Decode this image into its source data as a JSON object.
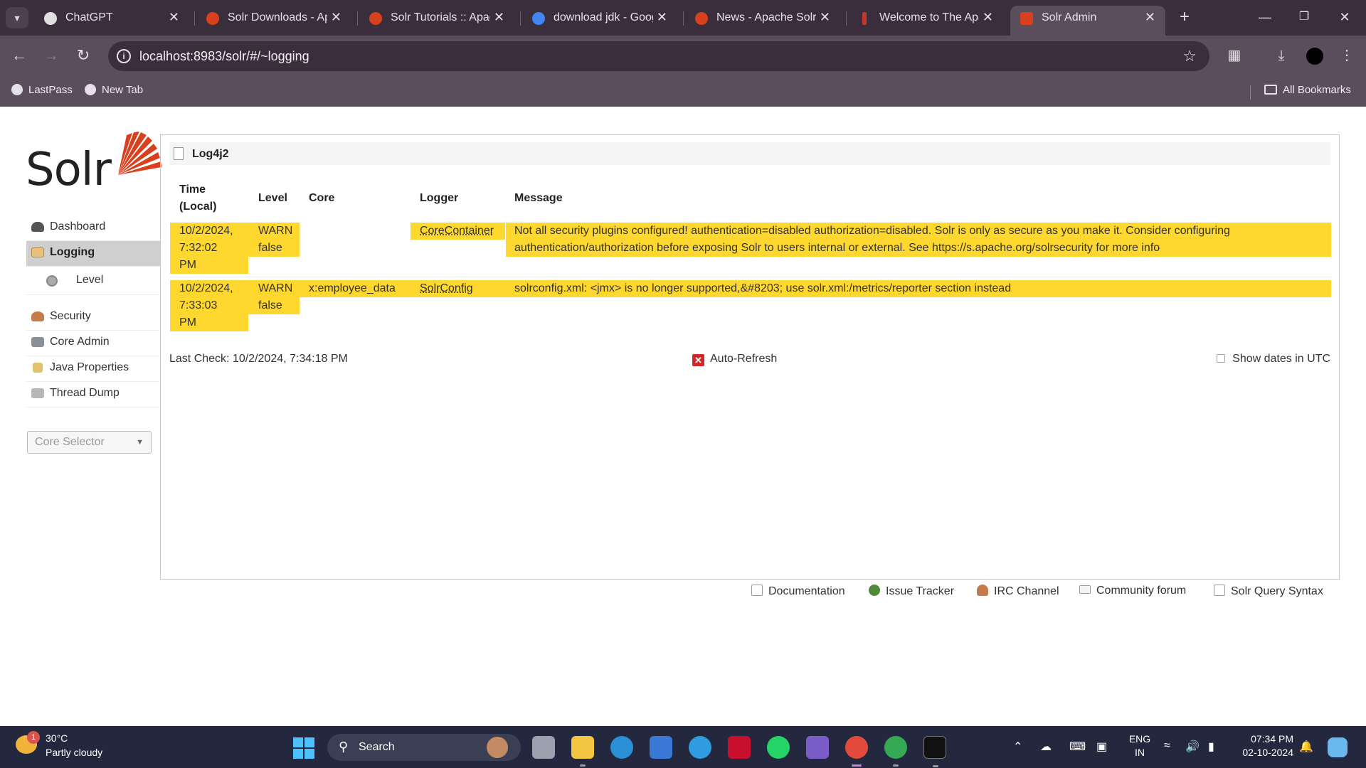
{
  "browser": {
    "tabs": [
      {
        "title": "ChatGPT",
        "favicon_color": "#e0e0e0",
        "active": false
      },
      {
        "title": "Solr Downloads - Apa",
        "favicon_color": "#d9411e",
        "active": false
      },
      {
        "title": "Solr Tutorials :: Apach",
        "favicon_color": "#d9411e",
        "active": false
      },
      {
        "title": "download jdk - Goog",
        "favicon_color": "#4285f4",
        "active": false
      },
      {
        "title": "News - Apache Solr (",
        "favicon_color": "#d9411e",
        "active": false
      },
      {
        "title": "Welcome to The Apa",
        "favicon_color": "#c0392b",
        "active": false
      },
      {
        "title": "Solr Admin",
        "favicon_color": "#d9411e",
        "active": true
      }
    ],
    "url": "localhost:8983/solr/#/~logging",
    "bookmarks": [
      {
        "label": "LastPass"
      },
      {
        "label": "New Tab"
      }
    ],
    "all_bookmarks": "All Bookmarks"
  },
  "solr": {
    "logo_text": "Solr",
    "nav": {
      "dashboard": "Dashboard",
      "logging": "Logging",
      "level": "Level",
      "security": "Security",
      "core_admin": "Core Admin",
      "java_properties": "Java Properties",
      "thread_dump": "Thread Dump"
    },
    "core_selector": "Core Selector",
    "panel_title": "Log4j2",
    "columns": {
      "time_line1": "Time",
      "time_line2": "(Local)",
      "level": "Level",
      "core": "Core",
      "logger": "Logger",
      "message": "Message"
    },
    "rows": [
      {
        "time_date": "10/2/2024,",
        "time_clock": "7:32:02",
        "time_ampm": "PM",
        "level": "WARN",
        "level_flag": "false",
        "core": "",
        "logger": "CoreContainer",
        "message_line1": "Not all security plugins configured! authentication=disabled authorization=disabled. Solr is only as secure as you make it. Consider configuring",
        "message_line2": "authentication/authorization before exposing Solr to users internal or external. See https://s.apache.org/solrsecurity for more info"
      },
      {
        "time_date": "10/2/2024,",
        "time_clock": "7:33:03",
        "time_ampm": "PM",
        "level": "WARN",
        "level_flag": "false",
        "core": "x:employee_data",
        "logger": "SolrConfig",
        "message_line1": "solrconfig.xml: <jmx> is no longer supported,&#8203; use solr.xml:/metrics/reporter section instead",
        "message_line2": ""
      }
    ],
    "last_check": "Last Check: 10/2/2024, 7:34:18 PM",
    "auto_refresh": "Auto-Refresh",
    "show_dates_utc": "Show dates in UTC",
    "footer_links": {
      "documentation": "Documentation",
      "issue_tracker": "Issue Tracker",
      "irc_channel": "IRC Channel",
      "community_forum": "Community forum",
      "query_syntax": "Solr Query Syntax"
    },
    "colors": {
      "highlight": "#fed82f",
      "active_nav": "#cfcfcf",
      "brand": "#d9411e"
    }
  },
  "taskbar": {
    "weather_temp": "30°C",
    "weather_cond": "Partly cloudy",
    "weather_badge": "1",
    "search_label": "Search",
    "lang_line1": "ENG",
    "lang_line2": "IN",
    "time": "07:34 PM",
    "date": "02-10-2024"
  }
}
